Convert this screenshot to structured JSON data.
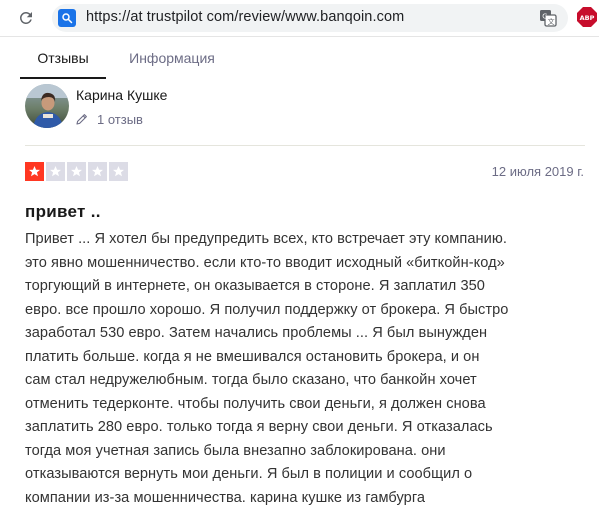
{
  "browser": {
    "url": "https://at trustpilot com/review/www.banqoin.com",
    "icons": [
      "reload-icon",
      "site-info-icon",
      "translate-icon",
      "adblock-plus-icon"
    ]
  },
  "tabs": [
    {
      "label": "Отзывы",
      "active": true
    },
    {
      "label": "Информация",
      "active": false
    }
  ],
  "reviewer": {
    "name": "Карина Кушке",
    "review_count": "1 отзыв"
  },
  "review": {
    "rating": 1,
    "max_rating": 5,
    "date": "12 июля 2019 г.",
    "title": "привет ..",
    "body_lines": [
      "Привет ... Я хотел бы предупредить всех, кто встречает эту компанию.",
      "это явно мошенничество. если кто-то вводит исходный «биткойн-код»",
      "торгующий в интернете, он оказывается в стороне. Я заплатил 350",
      "евро. все прошло хорошо. Я получил поддержку от брокера. Я быстро",
      "заработал 530 евро. Затем начались проблемы ... Я был вынужден",
      "платить больше. когда я не вмешивался остановить брокера, и он",
      "сам стал недружелюбным. тогда было сказано, что банкойн хочет",
      "отменить тедерконте. чтобы получить свои деньги, я должен снова",
      "заплатить 280 евро. только тогда я верну свои деньги. Я отказалась",
      "тогда моя учетная запись была внезапно заблокирована. они",
      "отказываются вернуть мои деньги. Я был в полиции и сообщил о",
      "компании из-за мошенничества. карина кушке из гамбурга"
    ]
  },
  "colors": {
    "star_filled": "#ff3722",
    "star_empty": "#dcdce6",
    "accent_blue": "#1a73e8",
    "abp_red": "#c70d2c",
    "muted_text": "#6c6c85"
  }
}
